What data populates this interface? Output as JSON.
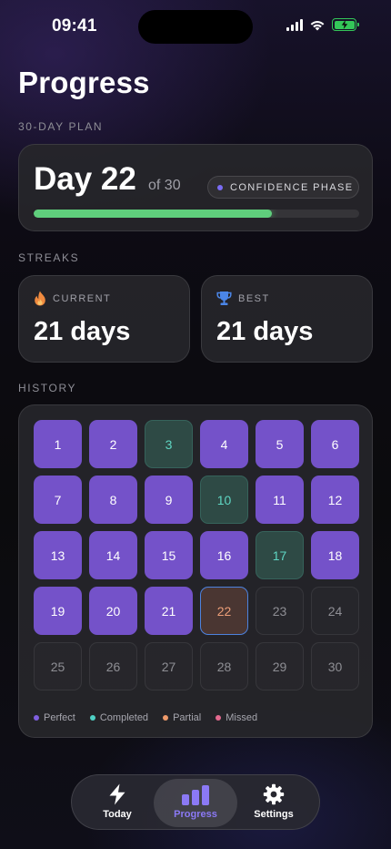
{
  "status_bar": {
    "time": "09:41",
    "icons": [
      "signal-icon",
      "wifi-icon",
      "battery-charging-icon"
    ]
  },
  "page": {
    "title": "Progress"
  },
  "plan": {
    "section_label": "30-DAY PLAN",
    "day_label": "Day 22",
    "of_label": "of 30",
    "phase": "CONFIDENCE PHASE",
    "progress_fraction": 0.733,
    "colors": {
      "progress": "#5fce7c",
      "phase_dot": "#7a6cf5"
    }
  },
  "streaks": {
    "section_label": "STREAKS",
    "current": {
      "label": "CURRENT",
      "value": "21 days",
      "icon": "flame-icon"
    },
    "best": {
      "label": "BEST",
      "value": "21 days",
      "icon": "trophy-icon"
    }
  },
  "history": {
    "section_label": "HISTORY",
    "days": [
      {
        "day": "1",
        "status": "perfect"
      },
      {
        "day": "2",
        "status": "perfect"
      },
      {
        "day": "3",
        "status": "partial"
      },
      {
        "day": "4",
        "status": "perfect"
      },
      {
        "day": "5",
        "status": "perfect"
      },
      {
        "day": "6",
        "status": "perfect"
      },
      {
        "day": "7",
        "status": "perfect"
      },
      {
        "day": "8",
        "status": "perfect"
      },
      {
        "day": "9",
        "status": "perfect"
      },
      {
        "day": "10",
        "status": "partial"
      },
      {
        "day": "11",
        "status": "perfect"
      },
      {
        "day": "12",
        "status": "perfect"
      },
      {
        "day": "13",
        "status": "perfect"
      },
      {
        "day": "14",
        "status": "perfect"
      },
      {
        "day": "15",
        "status": "perfect"
      },
      {
        "day": "16",
        "status": "perfect"
      },
      {
        "day": "17",
        "status": "partial"
      },
      {
        "day": "18",
        "status": "perfect"
      },
      {
        "day": "19",
        "status": "perfect"
      },
      {
        "day": "20",
        "status": "perfect"
      },
      {
        "day": "21",
        "status": "perfect"
      },
      {
        "day": "22",
        "status": "today"
      },
      {
        "day": "23",
        "status": "future"
      },
      {
        "day": "24",
        "status": "future"
      },
      {
        "day": "25",
        "status": "future"
      },
      {
        "day": "26",
        "status": "future"
      },
      {
        "day": "27",
        "status": "future"
      },
      {
        "day": "28",
        "status": "future"
      },
      {
        "day": "29",
        "status": "future"
      },
      {
        "day": "30",
        "status": "future"
      }
    ],
    "legend": [
      {
        "label": "Perfect",
        "color": "#7f5fe0"
      },
      {
        "label": "Completed",
        "color": "#4fd1c5"
      },
      {
        "label": "Partial",
        "color": "#ee9a6a"
      },
      {
        "label": "Missed",
        "color": "#e46a8f"
      }
    ]
  },
  "tab_bar": {
    "tabs": [
      {
        "label": "Today",
        "icon": "bolt-icon",
        "active": false
      },
      {
        "label": "Progress",
        "icon": "bar-chart-icon",
        "active": true
      },
      {
        "label": "Settings",
        "icon": "gear-icon",
        "active": false
      }
    ],
    "colors": {
      "active": "#8b79f5"
    }
  }
}
